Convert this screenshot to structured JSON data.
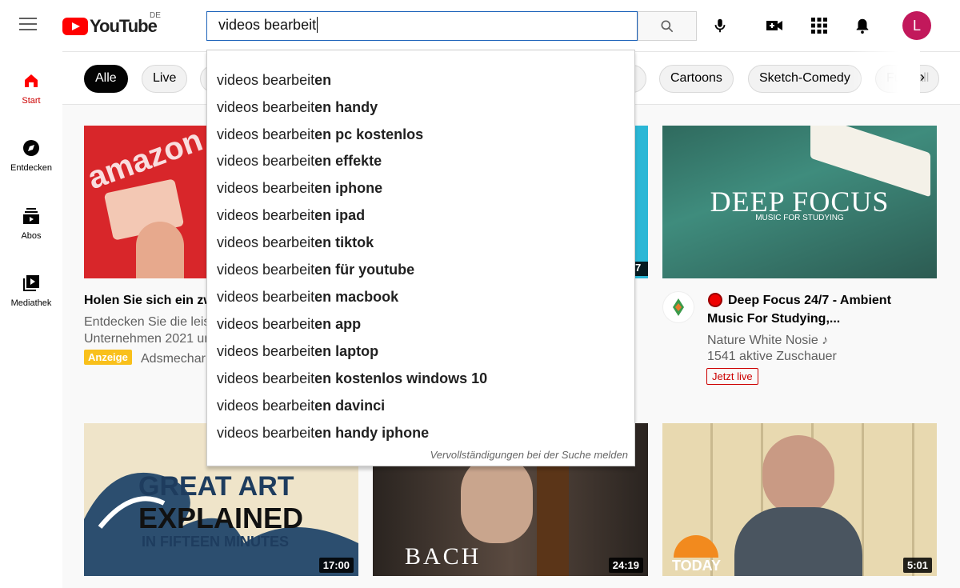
{
  "header": {
    "logo_text": "YouTube",
    "country_code": "DE",
    "search_value": "videos bearbeit",
    "avatar_letter": "L",
    "colors": {
      "brand": "#ff0000",
      "avatar": "#c2185b",
      "search_border": "#1c62b9"
    }
  },
  "sidebar": {
    "items": [
      {
        "label": "Start",
        "icon": "home-icon"
      },
      {
        "label": "Entdecken",
        "icon": "compass-icon"
      },
      {
        "label": "Abos",
        "icon": "subscriptions-icon"
      },
      {
        "label": "Mediathek",
        "icon": "library-icon"
      }
    ]
  },
  "chips": {
    "items": [
      "Alle",
      "Live",
      "Cartoons",
      "Sketch-Comedy",
      "Fußball"
    ]
  },
  "suggestions": {
    "prefix": "videos bearbeit",
    "items": [
      "en",
      "en handy",
      "en pc kostenlos",
      "en effekte",
      "en iphone",
      "en ipad",
      "en tiktok",
      "en für youtube",
      "en macbook",
      "en app",
      "en laptop",
      "en kostenlos windows 10",
      "en davinci",
      "en handy iphone"
    ],
    "report_link": "Vervollständigungen bei der Suche melden"
  },
  "videos": {
    "ad": {
      "title": "Holen Sie sich ein zw",
      "desc_line1": "Entdecken Sie die leis",
      "desc_line2": "Unternehmen 2021 ur",
      "badge": "Anzeige",
      "channel": "Adsmechar",
      "thumb_text": "amazon"
    },
    "middle": {
      "duration": "7"
    },
    "deepfocus": {
      "thumb_title": "DEEP FOCUS",
      "thumb_subtitle": "MUSIC FOR STUDYING",
      "title_line1": "Deep Focus 24/7 - Ambient",
      "title_line2": "Music For Studying,...",
      "channel": "Nature White Nosie",
      "viewers": "1541 aktive Zuschauer",
      "live_badge": "Jetzt live"
    },
    "row2": [
      {
        "thumb_text1": "GREAT ART",
        "thumb_text2": "EXPLAINED",
        "thumb_text3": "IN FIFTEEN MINUTES",
        "duration": "17:00"
      },
      {
        "thumb_text": "BACH",
        "duration": "24:19"
      },
      {
        "thumb_text": "TODAY",
        "duration": "5:01"
      }
    ]
  }
}
